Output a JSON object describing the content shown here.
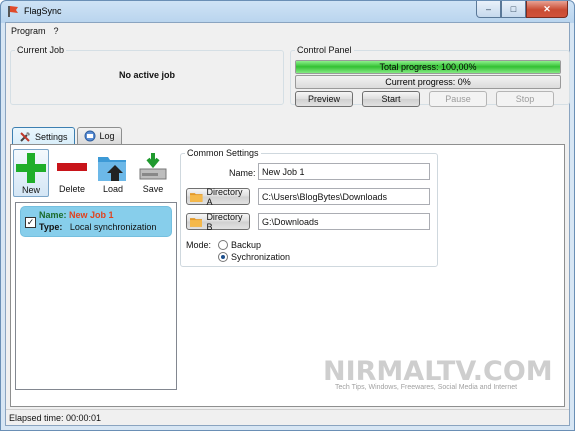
{
  "window": {
    "title": "FlagSync",
    "buttons": {
      "minimize": "‒",
      "maximize": "□",
      "close": "✕"
    }
  },
  "menu": [
    "Program",
    "?"
  ],
  "current_job": {
    "title": "Current Job",
    "status": "No active job"
  },
  "control_panel": {
    "title": "Control Panel",
    "total_progress_label": "Total progress: 100,00%",
    "total_progress_value": 1.0,
    "current_progress_label": "Current progress: 0%",
    "current_progress_value": 0.0,
    "buttons": {
      "preview": {
        "label": "Preview",
        "enabled": true
      },
      "start": {
        "label": "Start",
        "enabled": true
      },
      "pause": {
        "label": "Pause",
        "enabled": false
      },
      "stop": {
        "label": "Stop",
        "enabled": false
      }
    }
  },
  "tabs": [
    {
      "label": "Settings",
      "icon": "tools-icon",
      "active": true
    },
    {
      "label": "Log",
      "icon": "log-icon",
      "active": false
    }
  ],
  "toolbar": {
    "new": {
      "label": "New",
      "icon": "plus-icon"
    },
    "delete": {
      "label": "Delete",
      "icon": "minus-icon"
    },
    "load": {
      "label": "Load",
      "icon": "folder-upload-icon"
    },
    "save": {
      "label": "Save",
      "icon": "disk-save-icon"
    }
  },
  "jobs": [
    {
      "name_key": "Name:",
      "name": "New Job 1",
      "type_key": "Type:",
      "type": "Local synchronization",
      "checked": true
    }
  ],
  "common_settings": {
    "title": "Common Settings",
    "name_label": "Name:",
    "name_value": "New Job 1",
    "directory_a_label": "Directory A",
    "directory_a_value": "C:\\Users\\BlogBytes\\Downloads",
    "directory_b_label": "Directory B",
    "directory_b_value": "G:\\Downloads",
    "mode_label": "Mode:",
    "mode_options": [
      {
        "label": "Backup",
        "selected": false
      },
      {
        "label": "Sychronization",
        "selected": true
      }
    ]
  },
  "watermark": {
    "title": "NIRMALTV.COM",
    "subtitle": "Tech Tips, Windows, Freewares, Social Media and Internet"
  },
  "status": {
    "elapsed": "Elapsed time: 00:00:01"
  },
  "colors": {
    "progress_fill": "#3cc43c",
    "job_item_bg": "#87ceeb",
    "job_name": "#e0421e"
  }
}
